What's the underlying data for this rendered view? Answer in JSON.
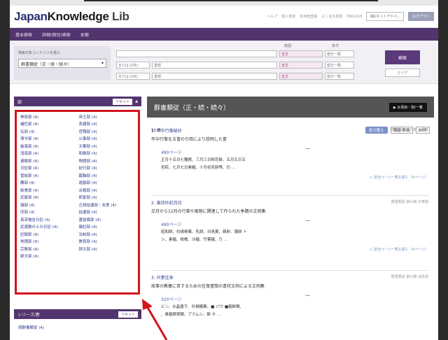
{
  "header": {
    "logo_main": "Japan",
    "logo_k": "Knowledge",
    "logo_lib": " Lib",
    "links": [
      "ヘルプ",
      "個人書架",
      "利用者登録",
      "よくある質問",
      "ENGLISH"
    ],
    "user_box": "(株)ネットアドバ...",
    "logout": "ログアウト"
  },
  "nav": {
    "items": [
      "基本検索",
      "詳細(個別)検索",
      "本棚"
    ]
  },
  "search": {
    "left_label": "検索対象コンテンツを選ぶ",
    "content_select": "群書類従（正・続・続々）",
    "col_field": "範囲",
    "col_cond": "条件",
    "rows": [
      {
        "op": "",
        "field": "全文",
        "cond": "部分一致"
      },
      {
        "op": "または (OR)",
        "term": "書題",
        "field": "全文",
        "cond": "部分一致"
      },
      {
        "op": "または (OR)",
        "term": "書題",
        "field": "全文",
        "cond": "部分一致"
      }
    ],
    "search_button": "検索",
    "clear_button": "クリア"
  },
  "sidebar": {
    "facet_title": "部",
    "reset_label": "リセット",
    "facets": [
      [
        "神祇部 (4)",
        "帝王部 (4)"
      ],
      [
        "補任部 (4)",
        "系譜部 (4)"
      ],
      [
        "伝部 (4)",
        "官職部 (4)"
      ],
      [
        "律令部 (4)",
        "公事部 (4)"
      ],
      [
        "装束部 (4)",
        "文筆部 (4)"
      ],
      [
        "消息部 (4)",
        "和歌部 (4)"
      ],
      [
        "連歌部 (4)",
        "物語部 (4)"
      ],
      [
        "日記部 (4)",
        "紀行部 (4)"
      ],
      [
        "管絃部 (4)",
        "蹴鞠部 (4)"
      ],
      [
        "鷹部 (4)",
        "遊戯部 (4)"
      ],
      [
        "飲食部 (4)",
        "合戦部 (4)"
      ],
      [
        "武家部 (4)",
        "釈家部 (4)"
      ],
      [
        "雑部 (4)",
        "正続拾遺部・本意 (4)"
      ],
      [
        "序部 (4)",
        "拾遺部 (4)"
      ],
      [
        "真済僧告日記 (4)",
        "善智識部 (4)"
      ],
      [
        "武運敵の上の日記 (4)",
        "御記部 (4)"
      ],
      [
        "記録部 (4)",
        "法制部 (4)"
      ],
      [
        "地理部 (4)",
        "教育部 (4)"
      ],
      [
        "宗教部 (4)",
        "辞文部 (4)"
      ],
      [
        "辭文部 (4)",
        ""
      ]
    ],
    "series_title": "シリーズ/巻",
    "series_reset": "リセット",
    "series_item": "続群書類従 (4)"
  },
  "main": {
    "title": "群書類従（正・続・続々）",
    "tag": "▶ 大項目・別/一覧",
    "count": "33 件",
    "sort_pill": "並び替え",
    "sort_label": "書題 昇順",
    "per_page": "20件",
    "results": [
      {
        "title": "1. 年中行事秘抄",
        "sub": "年中行事を古書の引用により説明した書",
        "src": "群書類従 第六輯 公事部",
        "page": "480ページ",
        "lines": [
          "正月十五日七種粥、三月三日桃花餅、五月五日五",
          "色粽、七月七日素麺、十月初亥餅等、仍 ..."
        ],
        "more": "▷ 該当ページ一覧を開く（4ページ）"
      },
      {
        "title": "2. 寅卯抄記月日",
        "sub": "正月から12月の行事や風物に関連して作られた季題の文例集",
        "src": "群書類従 第九輯 文筆部",
        "page": "480ページ",
        "lines": [
          "昭和餅、杉楊柳菓、乳餅、白鳥糞、鶏卵、薄餅 ト",
          "シ、素麺、柑橘、冷麺、竹葉麺、乃 ..."
        ],
        "more": "▷ 該当ページ一覧を開く（4ページ）"
      },
      {
        "title": "3. 尺素往来",
        "sub": "故事の教養に資するための往復書簡の書状文例による文例集",
        "src": "群書類従 第九輯 消息部",
        "page": "320ページ",
        "lines": [
          "ビン、水晶唐子、杉楊糖菓、■ パウ ■麺餅類、",
          "、素麺寒粥類、アクムシ、餅 キ ..."
        ],
        "more": ""
      }
    ]
  },
  "colors": {
    "brand": "#52356e",
    "highlight_border": "#d4141c",
    "link": "#2a3a8a"
  }
}
